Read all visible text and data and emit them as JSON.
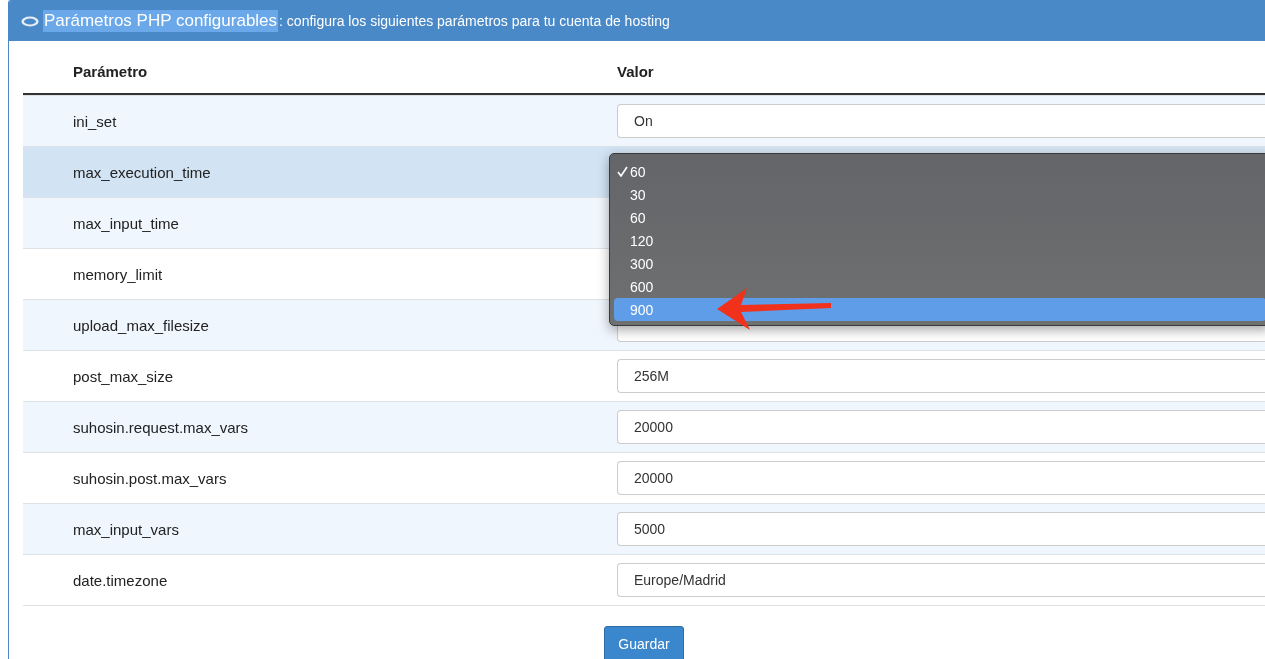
{
  "panel": {
    "title": "Parámetros PHP configurables",
    "title_highlighted": true,
    "subtitle": ": configura los siguientes parámetros para tu cuenta de hosting"
  },
  "table": {
    "columns": [
      "Parámetro",
      "Valor"
    ],
    "rows": [
      {
        "name": "ini_set",
        "kind": "field",
        "value": "On",
        "highlighted": false
      },
      {
        "name": "max_execution_time",
        "highlighted": true
      },
      {
        "name": "max_input_time",
        "highlighted": false
      },
      {
        "name": "memory_limit",
        "highlighted": false
      },
      {
        "name": "upload_max_filesize",
        "kind": "field",
        "highlighted": false
      },
      {
        "name": "post_max_size",
        "kind": "field",
        "value": "256M",
        "highlighted": false
      },
      {
        "name": "suhosin.request.max_vars",
        "kind": "field",
        "value": "20000",
        "highlighted": false
      },
      {
        "name": "suhosin.post.max_vars",
        "kind": "field",
        "value": "20000",
        "highlighted": false
      },
      {
        "name": "max_input_vars",
        "kind": "field",
        "value": "5000",
        "highlighted": false
      },
      {
        "name": "date.timezone",
        "kind": "field",
        "value": "Europe/Madrid",
        "highlighted": false
      }
    ]
  },
  "dropdown": {
    "options": [
      {
        "label": "60",
        "checked": true,
        "highlighted": false
      },
      {
        "label": "30",
        "checked": false,
        "highlighted": false
      },
      {
        "label": "60",
        "checked": false,
        "highlighted": false
      },
      {
        "label": "120",
        "checked": false,
        "highlighted": false
      },
      {
        "label": "300",
        "checked": false,
        "highlighted": false
      },
      {
        "label": "600",
        "checked": false,
        "highlighted": false
      },
      {
        "label": "900",
        "checked": false,
        "highlighted": true
      }
    ]
  },
  "save_button": "Guardar"
}
